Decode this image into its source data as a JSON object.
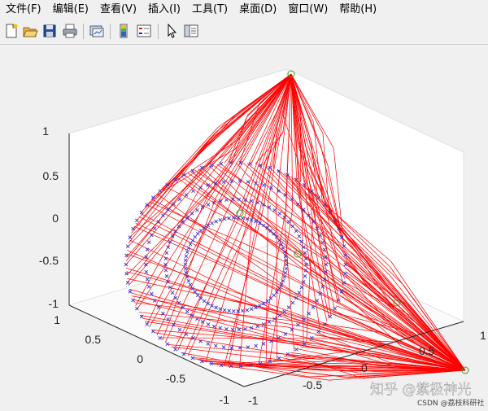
{
  "menu": [
    "文件(F)",
    "编辑(E)",
    "查看(V)",
    "插入(I)",
    "工具(T)",
    "桌面(D)",
    "窗口(W)",
    "帮助(H)"
  ],
  "toolbar": [
    {
      "name": "new-figure-icon"
    },
    {
      "name": "open-file-icon"
    },
    {
      "name": "save-icon"
    },
    {
      "name": "print-icon"
    },
    {
      "name": "link-plot-icon"
    },
    {
      "name": "colorbar-icon"
    },
    {
      "name": "legend-icon"
    },
    {
      "name": "pointer-icon"
    },
    {
      "name": "property-editor-icon"
    }
  ],
  "axes": {
    "z_ticks": [
      "1",
      "0.5",
      "0",
      "-0.5",
      "-1"
    ],
    "left_ticks": [
      "1",
      "0.5",
      "0",
      "-0.5",
      "-1"
    ],
    "right_ticks": [
      "-1",
      "-0.5",
      "0",
      "0.5",
      "1"
    ]
  },
  "colors": {
    "lines": "#ff0000",
    "markers": "#3333cc",
    "nodes": "#2ca02c"
  },
  "watermark": {
    "main": "知乎 @紫极神光",
    "sub": "CSDN @荔枝科研社"
  }
}
